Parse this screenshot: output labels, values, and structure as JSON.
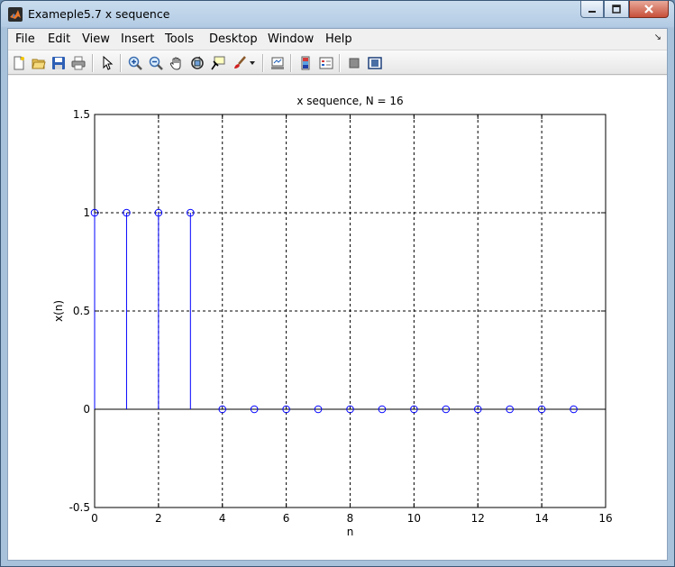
{
  "window": {
    "title": "Exameple5.7 x sequence"
  },
  "menu": {
    "items": [
      "File",
      "Edit",
      "View",
      "Insert",
      "Tools",
      "Desktop",
      "Window",
      "Help"
    ]
  },
  "toolbar": {
    "icons": [
      "new-figure-icon",
      "open-file-icon",
      "save-icon",
      "print-icon",
      "select-arrow-icon",
      "zoom-in-icon",
      "zoom-out-icon",
      "pan-hand-icon",
      "rotate-3d-icon",
      "data-cursor-icon",
      "brush-icon",
      "brush-dropdown-icon",
      "link-plot-icon",
      "colorbar-icon",
      "legend-icon",
      "hide-plot-tools-icon",
      "show-plot-tools-icon"
    ]
  },
  "chart_data": {
    "type": "stem",
    "title": "x sequence, N = 16",
    "xlabel": "n",
    "ylabel": "x(n)",
    "x": [
      0,
      1,
      2,
      3,
      4,
      5,
      6,
      7,
      8,
      9,
      10,
      11,
      12,
      13,
      14,
      15
    ],
    "values": [
      1,
      1,
      1,
      1,
      0,
      0,
      0,
      0,
      0,
      0,
      0,
      0,
      0,
      0,
      0,
      0
    ],
    "xlim": [
      0,
      16
    ],
    "ylim": [
      -0.5,
      1.5
    ],
    "xticks": [
      "0",
      "2",
      "4",
      "6",
      "8",
      "10",
      "12",
      "14",
      "16"
    ],
    "yticks": [
      "-0.5",
      "0",
      "0.5",
      "1",
      "1.5"
    ],
    "grid": true,
    "color": "#0000ff"
  }
}
